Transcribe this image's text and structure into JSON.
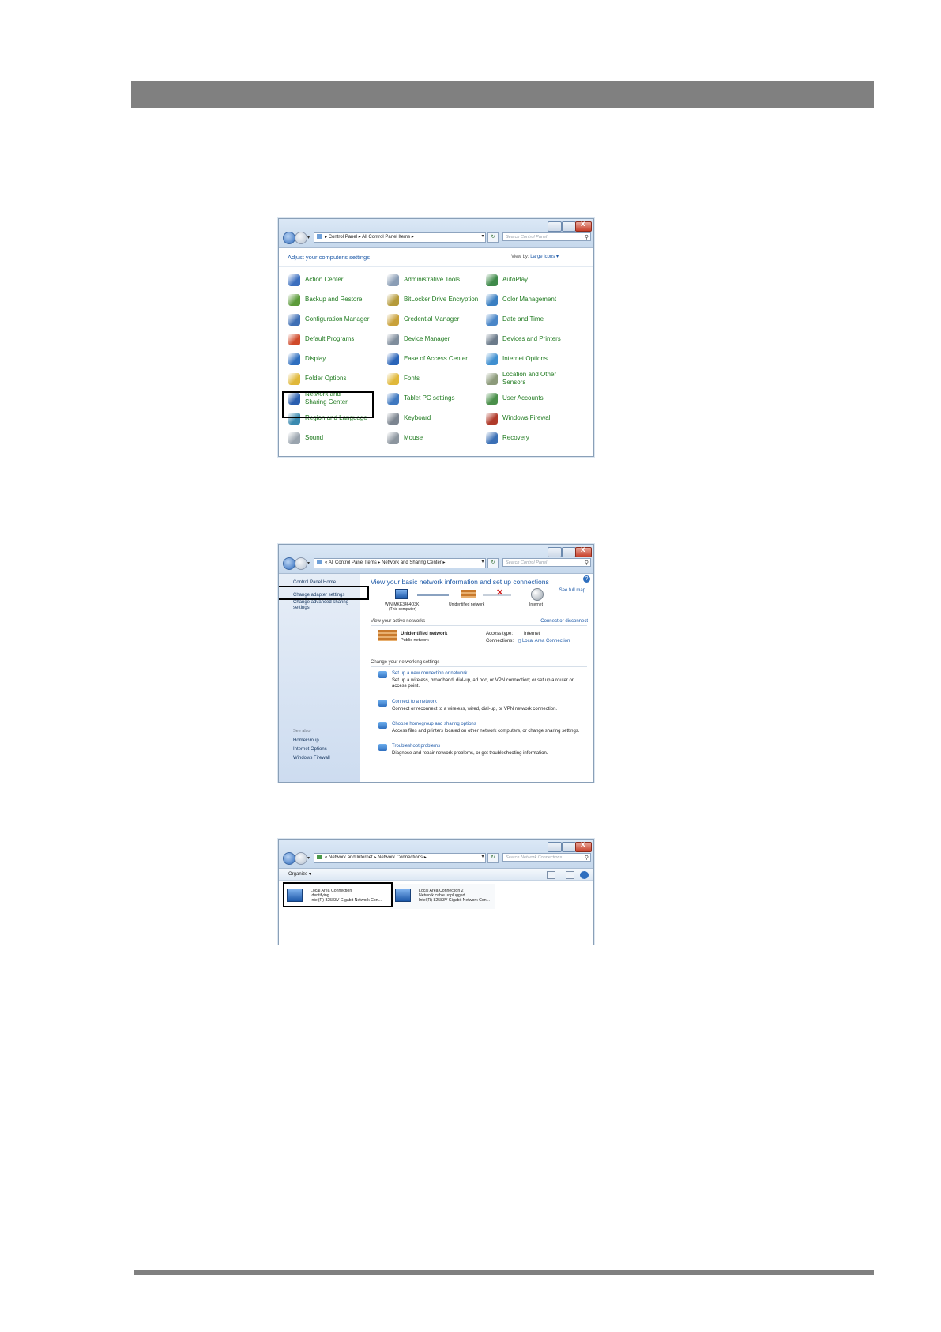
{
  "control_panel": {
    "address": [
      "Control Panel",
      "All Control Panel Items"
    ],
    "search_placeholder": "Search Control Panel",
    "heading": "Adjust your computer's settings",
    "view_by_label": "View by:",
    "view_by_value": "Large icons",
    "items": [
      {
        "label": "Action Center",
        "color": "#3c6fbf"
      },
      {
        "label": "Administrative Tools",
        "color": "#8a9db5"
      },
      {
        "label": "AutoPlay",
        "color": "#3f8a4a"
      },
      {
        "label": "Backup and Restore",
        "color": "#5c9b3a"
      },
      {
        "label": "BitLocker Drive Encryption",
        "color": "#b59a3a"
      },
      {
        "label": "Color Management",
        "color": "#3a7fc2"
      },
      {
        "label": "Configuration Manager",
        "color": "#3f6fb5"
      },
      {
        "label": "Credential Manager",
        "color": "#c9a13a"
      },
      {
        "label": "Date and Time",
        "color": "#4a86c8"
      },
      {
        "label": "Default Programs",
        "color": "#d04a2a"
      },
      {
        "label": "Device Manager",
        "color": "#7f8d9c"
      },
      {
        "label": "Devices and Printers",
        "color": "#6b7a8a"
      },
      {
        "label": "Display",
        "color": "#2f6fbf"
      },
      {
        "label": "Ease of Access Center",
        "color": "#2a64b8"
      },
      {
        "label": "Internet Options",
        "color": "#3f8fd0"
      },
      {
        "label": "Folder Options",
        "color": "#e0b83a"
      },
      {
        "label": "Fonts",
        "color": "#e0b83a"
      },
      {
        "label": "Location and Other Sensors",
        "color": "#8c9a7a"
      },
      {
        "label": "Network and Sharing Center",
        "color": "#2a5fb0"
      },
      {
        "label": "Tablet PC settings",
        "color": "#3f78c0"
      },
      {
        "label": "User Accounts",
        "color": "#4a8f4a"
      },
      {
        "label": "Region and Language",
        "color": "#3a8ab0"
      },
      {
        "label": "Keyboard",
        "color": "#7c8590"
      },
      {
        "label": "Windows Firewall",
        "color": "#b03a2a"
      },
      {
        "label": "Sound",
        "color": "#9aa4ae"
      },
      {
        "label": "Mouse",
        "color": "#8c959e"
      },
      {
        "label": "Recovery",
        "color": "#3a6fb5"
      }
    ]
  },
  "sharing_center": {
    "address": [
      "All Control Panel Items",
      "Network and Sharing Center"
    ],
    "search_placeholder": "Search Control Panel",
    "sidebar": {
      "home": "Control Panel Home",
      "links": [
        "Change adapter settings",
        "Change advanced sharing settings"
      ],
      "see_also_label": "See also",
      "see_also": [
        "HomeGroup",
        "Internet Options",
        "Windows Firewall"
      ]
    },
    "title": "View your basic network information and set up connections",
    "see_full_map": "See full map",
    "map": {
      "computer": "WIN-MKE3464Q3K",
      "computer_sub": "(This computer)",
      "network": "Unidentified network",
      "internet": "Internet"
    },
    "active_label": "View your active networks",
    "connect_disconnect": "Connect or disconnect",
    "network_name": "Unidentified network",
    "network_type": "Public network",
    "access_type_label": "Access type:",
    "access_type_value": "Internet",
    "connections_label": "Connections:",
    "connections_value": "Local Area Connection",
    "change_label": "Change your networking settings",
    "tasks": [
      {
        "title": "Set up a new connection or network",
        "desc": "Set up a wireless, broadband, dial-up, ad hoc, or VPN connection; or set up a router or access point."
      },
      {
        "title": "Connect to a network",
        "desc": "Connect or reconnect to a wireless, wired, dial-up, or VPN network connection."
      },
      {
        "title": "Choose homegroup and sharing options",
        "desc": "Access files and printers located on other network computers, or change sharing settings."
      },
      {
        "title": "Troubleshoot problems",
        "desc": "Diagnose and repair network problems, or get troubleshooting information."
      }
    ]
  },
  "network_connections": {
    "address": [
      "Network and Internet",
      "Network Connections"
    ],
    "search_placeholder": "Search Network Connections",
    "organize": "Organize",
    "connections": [
      {
        "name": "Local Area Connection",
        "status": "Identifying...",
        "adapter": "Intel(R) 82583V Gigabit Network Con..."
      },
      {
        "name": "Local Area Connection 2",
        "status": "Network cable unplugged",
        "adapter": "Intel(R) 82583V Gigabit Network Con..."
      }
    ]
  }
}
